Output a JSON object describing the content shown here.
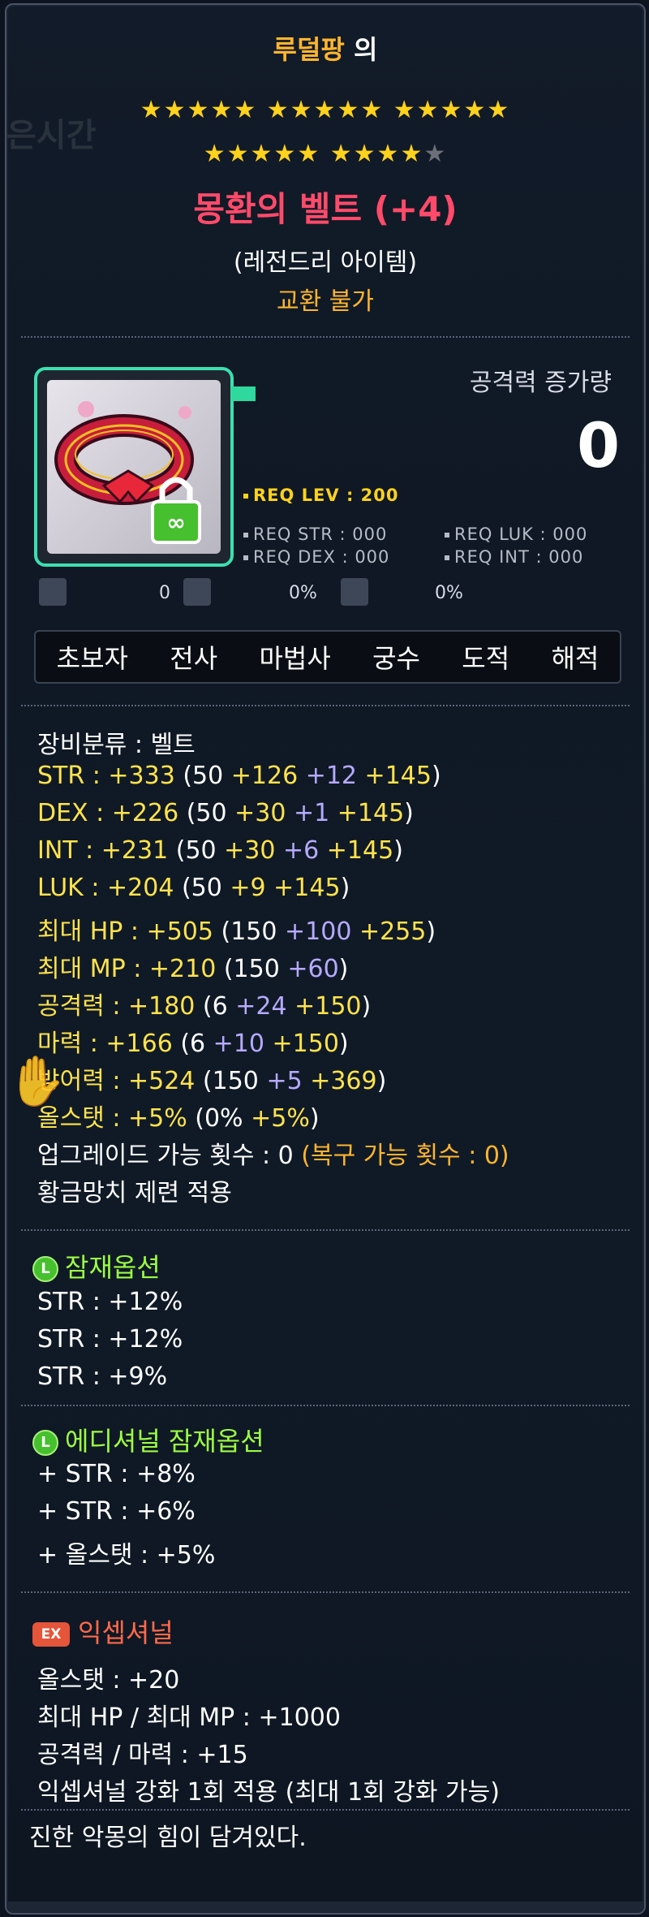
{
  "owner": {
    "name": "루덜팡",
    "suffix": "의"
  },
  "stars": {
    "row1": "★★★★★ ★★★★★ ★★★★★",
    "row2_on": "★★★★★ ★★★★",
    "row2_off": "★"
  },
  "item": {
    "name": "몽환의 벨트 (+4)",
    "grade": "(레전드리 아이템)",
    "trade": "교환 불가",
    "icon": "belt-icon"
  },
  "attack_increase": {
    "label": "공격력 증가량",
    "value": "0"
  },
  "requirements": {
    "lev": "REQ LEV : 200",
    "str": "REQ STR : 000",
    "luk": "REQ LUK : 000",
    "dex": "REQ DEX : 000",
    "int": "REQ INT : 000"
  },
  "mini_stats": {
    "a": "0",
    "b": "0%",
    "c": "0%"
  },
  "jobs": [
    "초보자",
    "전사",
    "마법사",
    "궁수",
    "도적",
    "해적"
  ],
  "stats": {
    "category": "장비분류 : 벨트",
    "str": {
      "label": "STR : +333",
      "open": " (50",
      "v1": " +126",
      "v2": " +12",
      "v3": " +145",
      "close": ")"
    },
    "dex": {
      "label": "DEX : +226",
      "open": " (50",
      "v1": " +30",
      "v2": " +1",
      "v3": " +145",
      "close": ")"
    },
    "int": {
      "label": "INT : +231",
      "open": " (50",
      "v1": " +30",
      "v2": " +6",
      "v3": " +145",
      "close": ")"
    },
    "luk": {
      "label": "LUK : +204",
      "open": " (50",
      "v1": " +9",
      "v3": " +145",
      "close": ")"
    },
    "hp": {
      "label": "최대 HP : +505",
      "open": " (150",
      "v2": " +100",
      "v3": " +255",
      "close": ")"
    },
    "mp": {
      "label": "최대 MP : +210",
      "open": " (150",
      "v2": " +60",
      "close": ")"
    },
    "atk": {
      "label": "공격력 : +180",
      "open": " (6",
      "v2": " +24",
      "v3": " +150",
      "close": ")"
    },
    "mag": {
      "label": "마력 : +166",
      "open": " (6",
      "v2": " +10",
      "v3": " +150",
      "close": ")"
    },
    "def": {
      "label": "방어력 : +524",
      "open": " (150",
      "v2": " +5",
      "v3": " +369",
      "close": ")"
    },
    "all": {
      "label": "올스탯 : +5%",
      "open": " (0%",
      "v3": " +5%",
      "close": ")"
    },
    "upgrade": "업그레이드 가능 횟수 : 0",
    "restore": " (복구 가능 횟수 : 0)",
    "golden": "황금망치 제련 적용"
  },
  "potential": {
    "icon_text": "L",
    "title": "잠재옵션",
    "lines": [
      "STR : +12%",
      "STR : +12%",
      "STR : +9%"
    ]
  },
  "additional": {
    "icon_text": "L",
    "title": "에디셔널 잠재옵션",
    "lines": [
      "+ STR : +8%",
      "+ STR : +6%",
      "+ 올스탯 : +5%"
    ]
  },
  "exceptional": {
    "icon_text": "EX",
    "title": "익셉셔널",
    "lines": [
      "올스탯 : +20",
      "최대 HP / 최대 MP : +1000",
      "공격력 / 마력 : +15",
      "익셉셔널 강화 1회 적용 (최대 1회 강화 가능)"
    ]
  },
  "description": "진한 악몽의 힘이 담겨있다."
}
